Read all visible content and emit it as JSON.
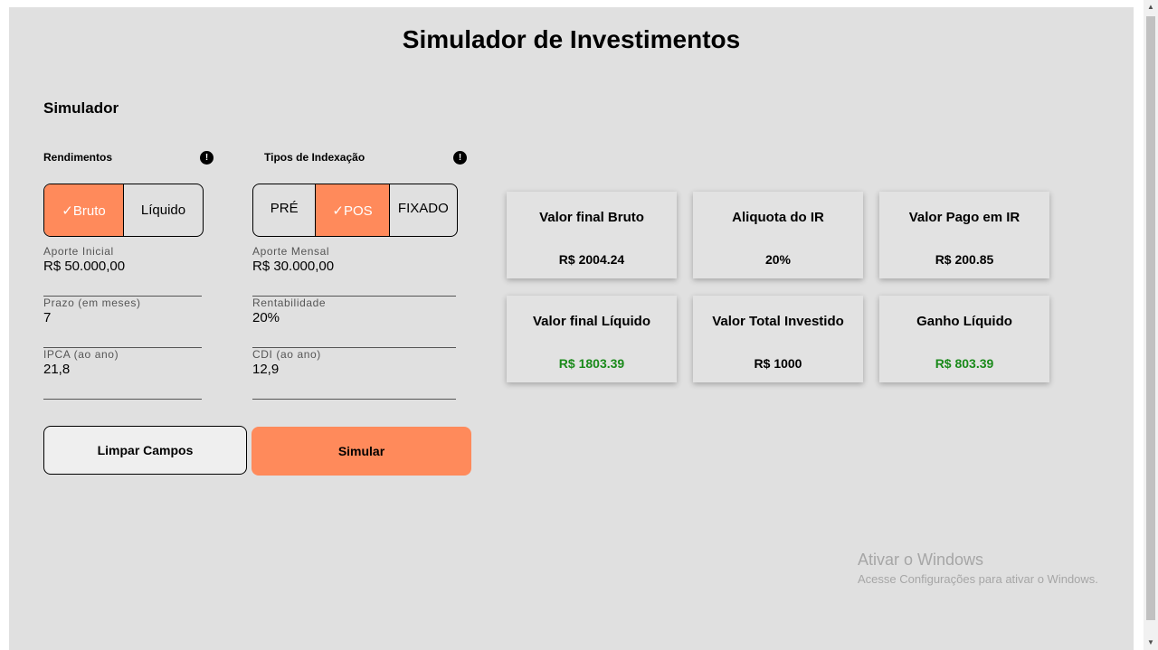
{
  "page": {
    "title": "Simulador de Investimentos",
    "section_title": "Simulador"
  },
  "rendimentos": {
    "label": "Rendimentos",
    "info_icon": "!",
    "options": [
      "✓Bruto",
      "Líquido"
    ],
    "selected": "✓Bruto"
  },
  "indexacao": {
    "label": "Tipos de Indexação",
    "info_icon": "!",
    "options": [
      "PRÉ",
      "✓POS",
      "FIXADO"
    ],
    "selected": "✓POS"
  },
  "fields_left": [
    {
      "label": "Aporte Inicial",
      "value": "R$ 50.000,00"
    },
    {
      "label": "Prazo (em meses)",
      "value": "7"
    },
    {
      "label": "IPCA (ao ano)",
      "value": "21,8"
    }
  ],
  "fields_right": [
    {
      "label": "Aporte Mensal",
      "value": "R$ 30.000,00"
    },
    {
      "label": "Rentabilidade",
      "value": "20%"
    },
    {
      "label": "CDI (ao ano)",
      "value": "12,9"
    }
  ],
  "buttons": {
    "clear": "Limpar Campos",
    "simulate": "Simular"
  },
  "results": [
    {
      "title": "Valor final Bruto",
      "value": "R$ 2004.24",
      "color": "#000000"
    },
    {
      "title": "Aliquota do IR",
      "value": "20%",
      "color": "#000000"
    },
    {
      "title": "Valor Pago em IR",
      "value": "R$ 200.85",
      "color": "#000000"
    },
    {
      "title": "Valor final Líquido",
      "value": "R$ 1803.39",
      "color": "#1a8a1a"
    },
    {
      "title": "Valor Total Investido",
      "value": "R$ 1000",
      "color": "#000000"
    },
    {
      "title": "Ganho Líquido",
      "value": "R$ 803.39",
      "color": "#1a8a1a"
    }
  ],
  "watermark": {
    "line1": "Ativar o Windows",
    "line2": "Acesse Configurações para ativar o Windows."
  },
  "colors": {
    "accent": "#ff8a5b",
    "background": "#e0e0e0",
    "positive": "#1a8a1a"
  }
}
